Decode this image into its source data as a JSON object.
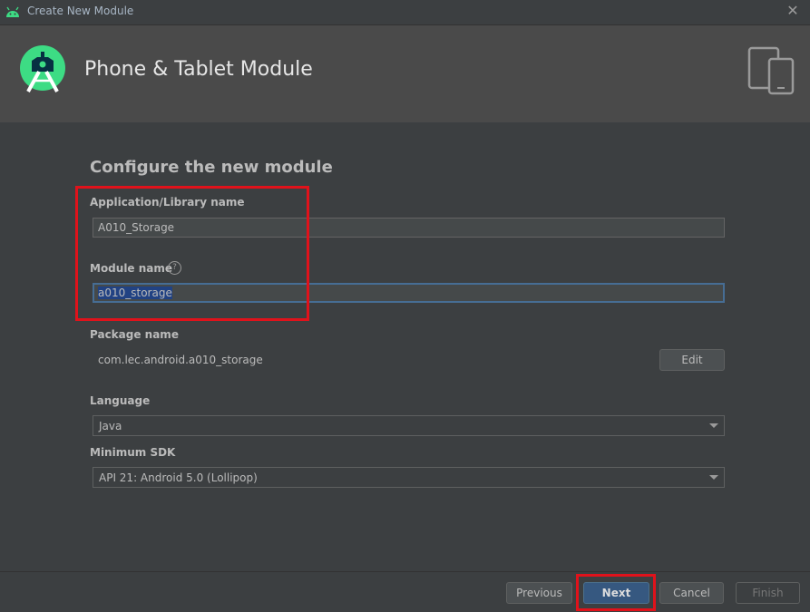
{
  "window": {
    "title": "Create New Module",
    "close_glyph": "✕"
  },
  "header": {
    "title": "Phone & Tablet Module",
    "logo_icon": "android-studio-logo-icon",
    "device_icon": "phone-tablet-icon"
  },
  "content": {
    "title": "Configure the new module",
    "app_name": {
      "label": "Application/Library name",
      "value": "A010_Storage"
    },
    "module_name": {
      "label": "Module name",
      "value": "a010_storage",
      "help_glyph": "?"
    },
    "package_name": {
      "label": "Package name",
      "value": "com.lec.android.a010_storage",
      "edit_label": "Edit"
    },
    "language": {
      "label": "Language",
      "selected": "Java"
    },
    "min_sdk": {
      "label": "Minimum SDK",
      "selected": "API 21: Android 5.0 (Lollipop)"
    }
  },
  "footer": {
    "previous_label": "Previous",
    "next_label": "Next",
    "cancel_label": "Cancel",
    "finish_label": "Finish"
  },
  "colors": {
    "accent": "#365880",
    "highlight": "#e0121b",
    "android_green": "#3ddc84"
  }
}
